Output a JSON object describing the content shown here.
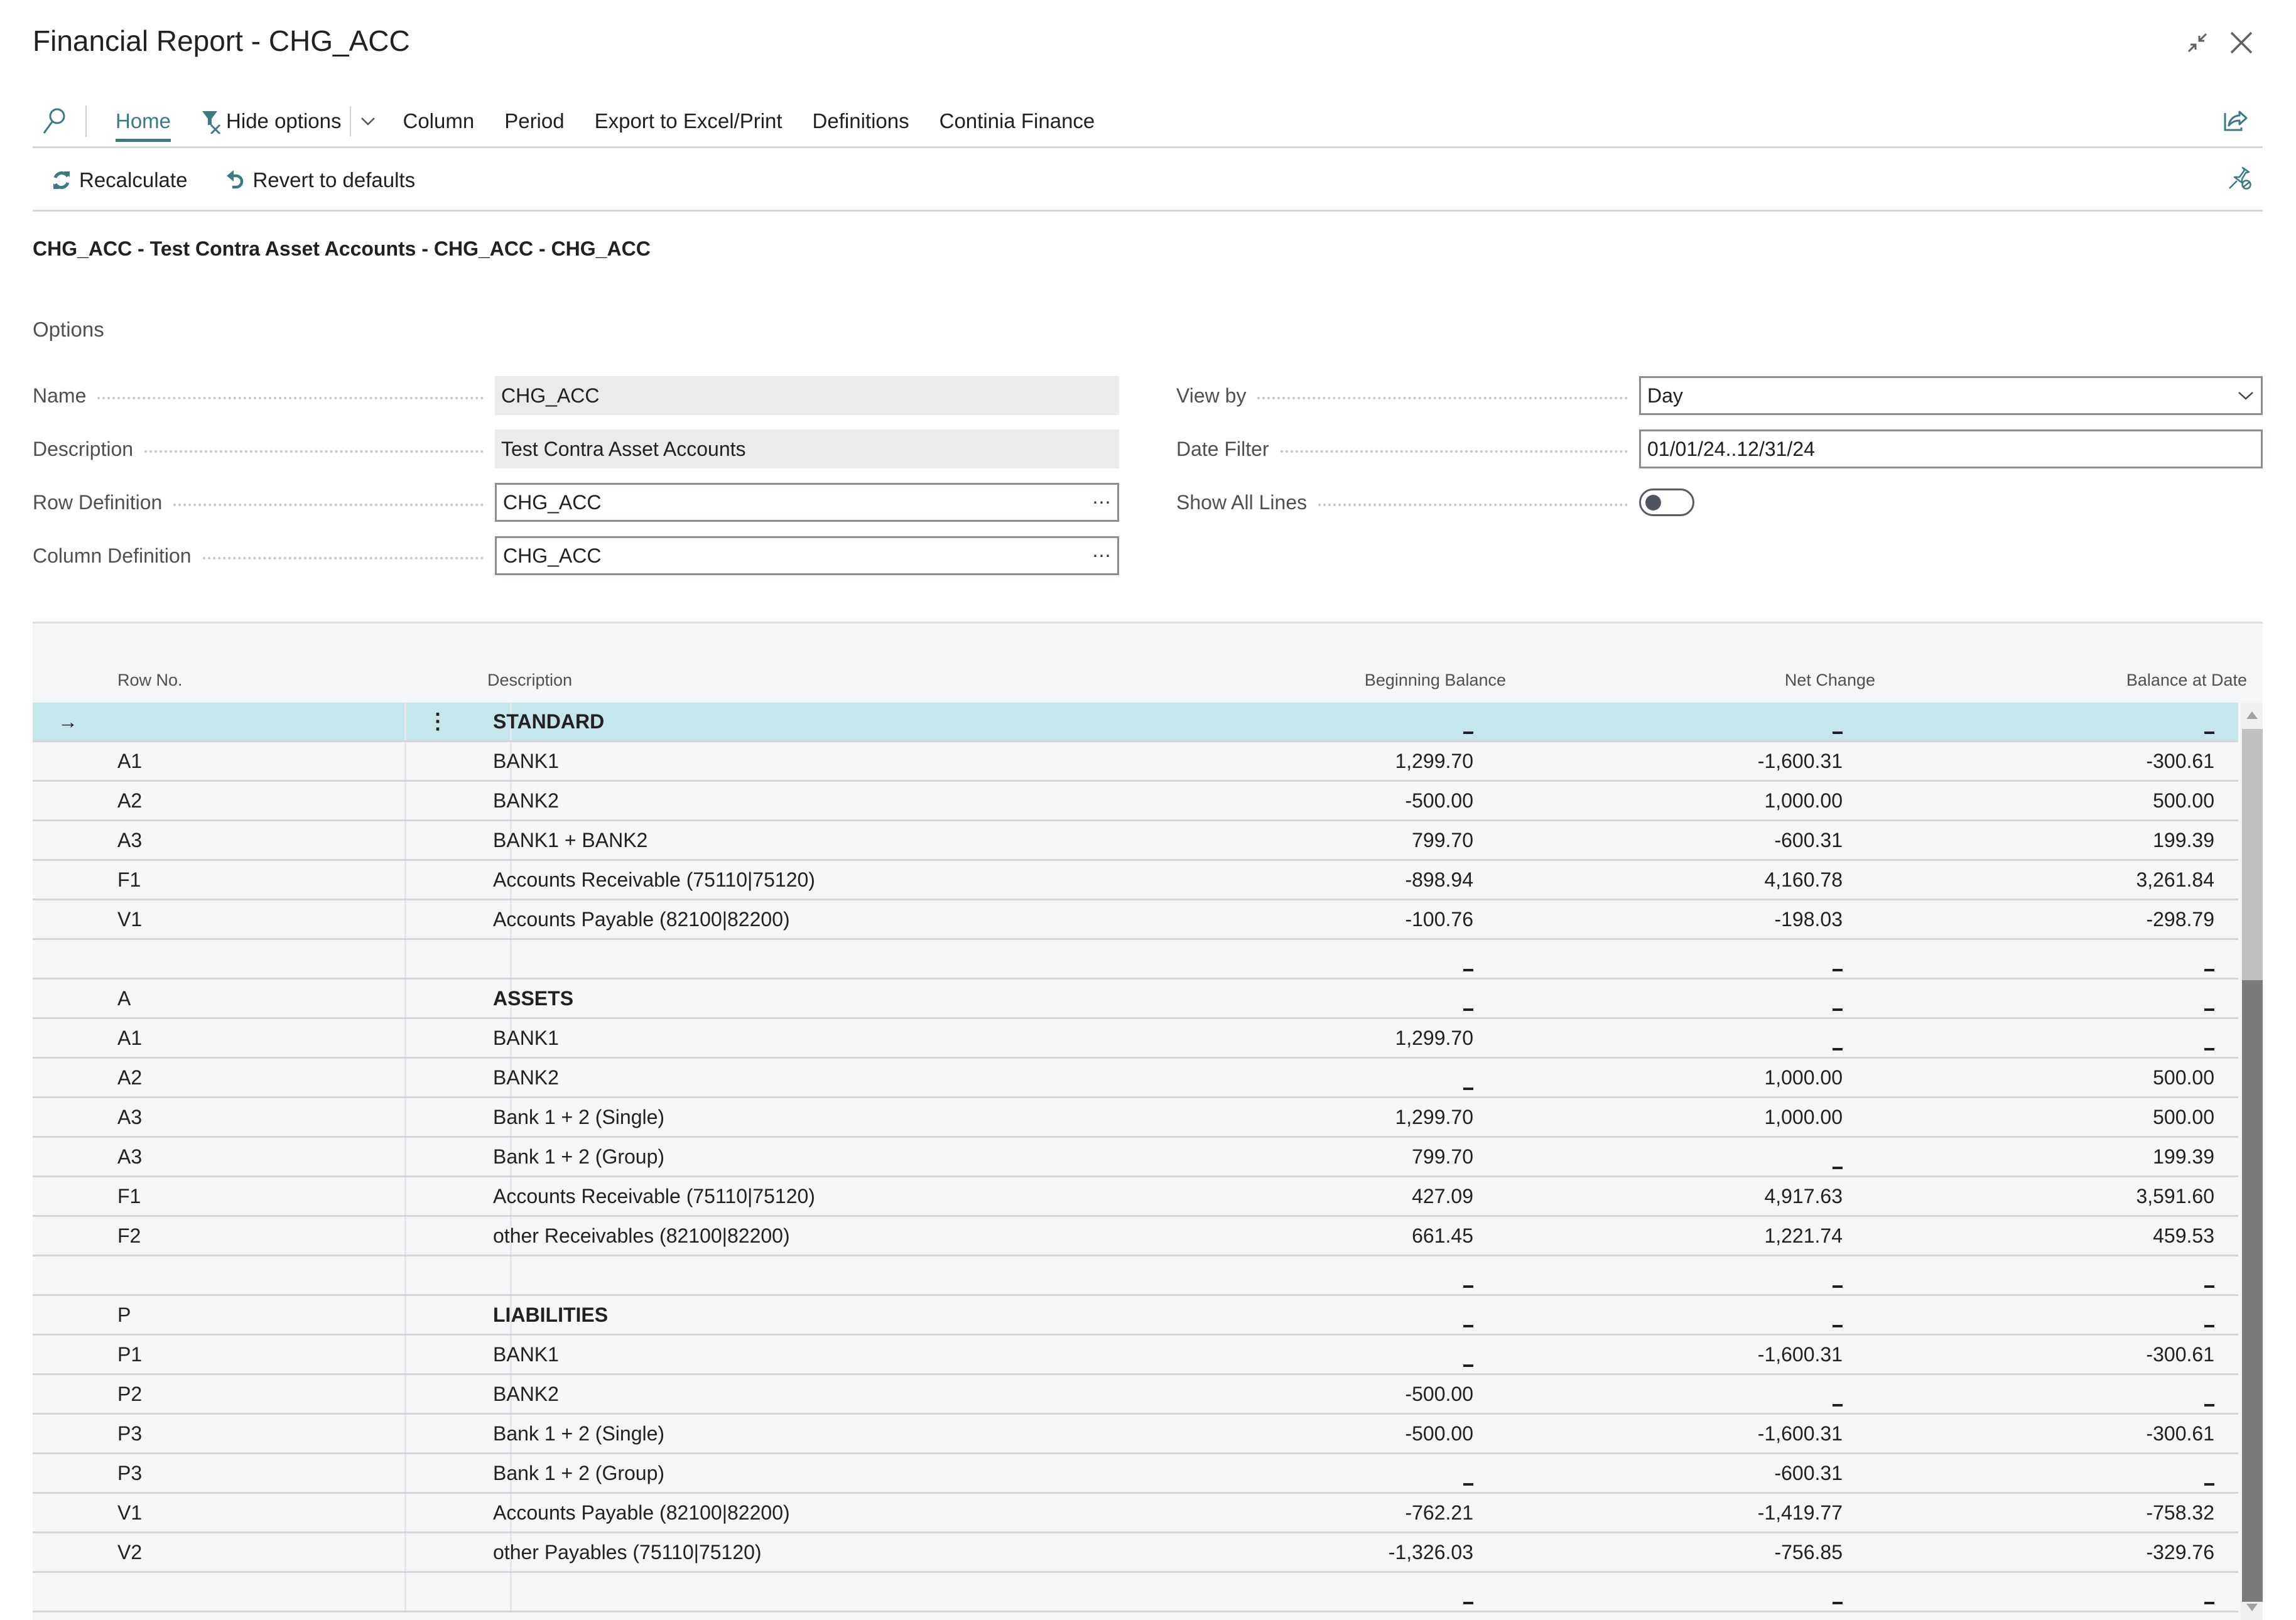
{
  "window": {
    "title": "Financial Report - CHG_ACC",
    "collapse_icon": "collapse-icon",
    "close_icon": "close-icon"
  },
  "toolbar": {
    "search_icon": "search-icon",
    "tabs": [
      {
        "label": "Home",
        "active": true
      },
      {
        "label": "Hide options",
        "icon": "filter-clear-icon"
      },
      {
        "label": "Column"
      },
      {
        "label": "Period"
      },
      {
        "label": "Export to Excel/Print"
      },
      {
        "label": "Definitions"
      },
      {
        "label": "Continia Finance"
      }
    ],
    "share_icon": "share-icon"
  },
  "actions": {
    "recalculate": "Recalculate",
    "revert": "Revert to defaults",
    "unpin_icon": "unpin-icon"
  },
  "subtitle": "CHG_ACC - Test Contra Asset Accounts - CHG_ACC - CHG_ACC",
  "options": {
    "heading": "Options",
    "name": {
      "label": "Name",
      "value": "CHG_ACC"
    },
    "description": {
      "label": "Description",
      "value": "Test Contra Asset Accounts"
    },
    "row_definition": {
      "label": "Row Definition",
      "value": "CHG_ACC"
    },
    "column_definition": {
      "label": "Column Definition",
      "value": "CHG_ACC"
    },
    "view_by": {
      "label": "View by",
      "value": "Day"
    },
    "date_filter": {
      "label": "Date Filter",
      "value": "01/01/24..12/31/24"
    },
    "show_all_lines": {
      "label": "Show All Lines",
      "value": false
    },
    "lookup_glyph": "⋯"
  },
  "table": {
    "columns": [
      "Row No.",
      "Description",
      "Beginning Balance",
      "Net Change",
      "Balance at Date"
    ],
    "rows": [
      {
        "row_no": "",
        "desc": "STANDARD",
        "bold": true,
        "selected": true,
        "bb": "_",
        "nc": "_",
        "bad": "_"
      },
      {
        "row_no": "A1",
        "desc": "BANK1",
        "bb": "1,299.70",
        "nc": "-1,600.31",
        "bad": "-300.61"
      },
      {
        "row_no": "A2",
        "desc": "BANK2",
        "bb": "-500.00",
        "nc": "1,000.00",
        "bad": "500.00"
      },
      {
        "row_no": "A3",
        "desc": "BANK1 + BANK2",
        "bb": "799.70",
        "nc": "-600.31",
        "bad": "199.39"
      },
      {
        "row_no": "F1",
        "desc": "Accounts Receivable (75110|75120)",
        "bb": "-898.94",
        "nc": "4,160.78",
        "bad": "3,261.84"
      },
      {
        "row_no": "V1",
        "desc": "Accounts Payable (82100|82200)",
        "bb": "-100.76",
        "nc": "-198.03",
        "bad": "-298.79"
      },
      {
        "row_no": "",
        "desc": "",
        "bb": "_",
        "nc": "_",
        "bad": "_"
      },
      {
        "row_no": "A",
        "desc": "ASSETS",
        "bold": true,
        "bb": "_",
        "nc": "_",
        "bad": "_"
      },
      {
        "row_no": "A1",
        "desc": "BANK1",
        "bb": "1,299.70",
        "nc": "_",
        "bad": "_"
      },
      {
        "row_no": "A2",
        "desc": "BANK2",
        "bb": "_",
        "nc": "1,000.00",
        "bad": "500.00"
      },
      {
        "row_no": "A3",
        "desc": "Bank 1 + 2 (Single)",
        "bb": "1,299.70",
        "nc": "1,000.00",
        "bad": "500.00"
      },
      {
        "row_no": "A3",
        "desc": "Bank 1 + 2 (Group)",
        "bb": "799.70",
        "nc": "_",
        "bad": "199.39"
      },
      {
        "row_no": "F1",
        "desc": "Accounts Receivable (75110|75120)",
        "bb": "427.09",
        "nc": "4,917.63",
        "bad": "3,591.60"
      },
      {
        "row_no": "F2",
        "desc": "other Receivables (82100|82200)",
        "bb": "661.45",
        "nc": "1,221.74",
        "bad": "459.53"
      },
      {
        "row_no": "",
        "desc": "",
        "bb": "_",
        "nc": "_",
        "bad": "_"
      },
      {
        "row_no": "P",
        "desc": "LIABILITIES",
        "bold": true,
        "bb": "_",
        "nc": "_",
        "bad": "_"
      },
      {
        "row_no": "P1",
        "desc": "BANK1",
        "bb": "_",
        "nc": "-1,600.31",
        "bad": "-300.61"
      },
      {
        "row_no": "P2",
        "desc": "BANK2",
        "bb": "-500.00",
        "nc": "_",
        "bad": "_"
      },
      {
        "row_no": "P3",
        "desc": "Bank 1 + 2 (Single)",
        "bb": "-500.00",
        "nc": "-1,600.31",
        "bad": "-300.61"
      },
      {
        "row_no": "P3",
        "desc": "Bank 1 + 2 (Group)",
        "bb": "_",
        "nc": "-600.31",
        "bad": "_"
      },
      {
        "row_no": "V1",
        "desc": "Accounts Payable (82100|82200)",
        "bb": "-762.21",
        "nc": "-1,419.77",
        "bad": "-758.32"
      },
      {
        "row_no": "V2",
        "desc": "other Payables (75110|75120)",
        "bb": "-1,326.03",
        "nc": "-756.85",
        "bad": "-329.76"
      },
      {
        "row_no": "",
        "desc": "",
        "bb": "_",
        "nc": "_",
        "bad": "_"
      }
    ]
  },
  "colors": {
    "accent": "#3c7a83",
    "selected_row": "#c5e7eb",
    "grid_bg": "#f5f6f8"
  }
}
